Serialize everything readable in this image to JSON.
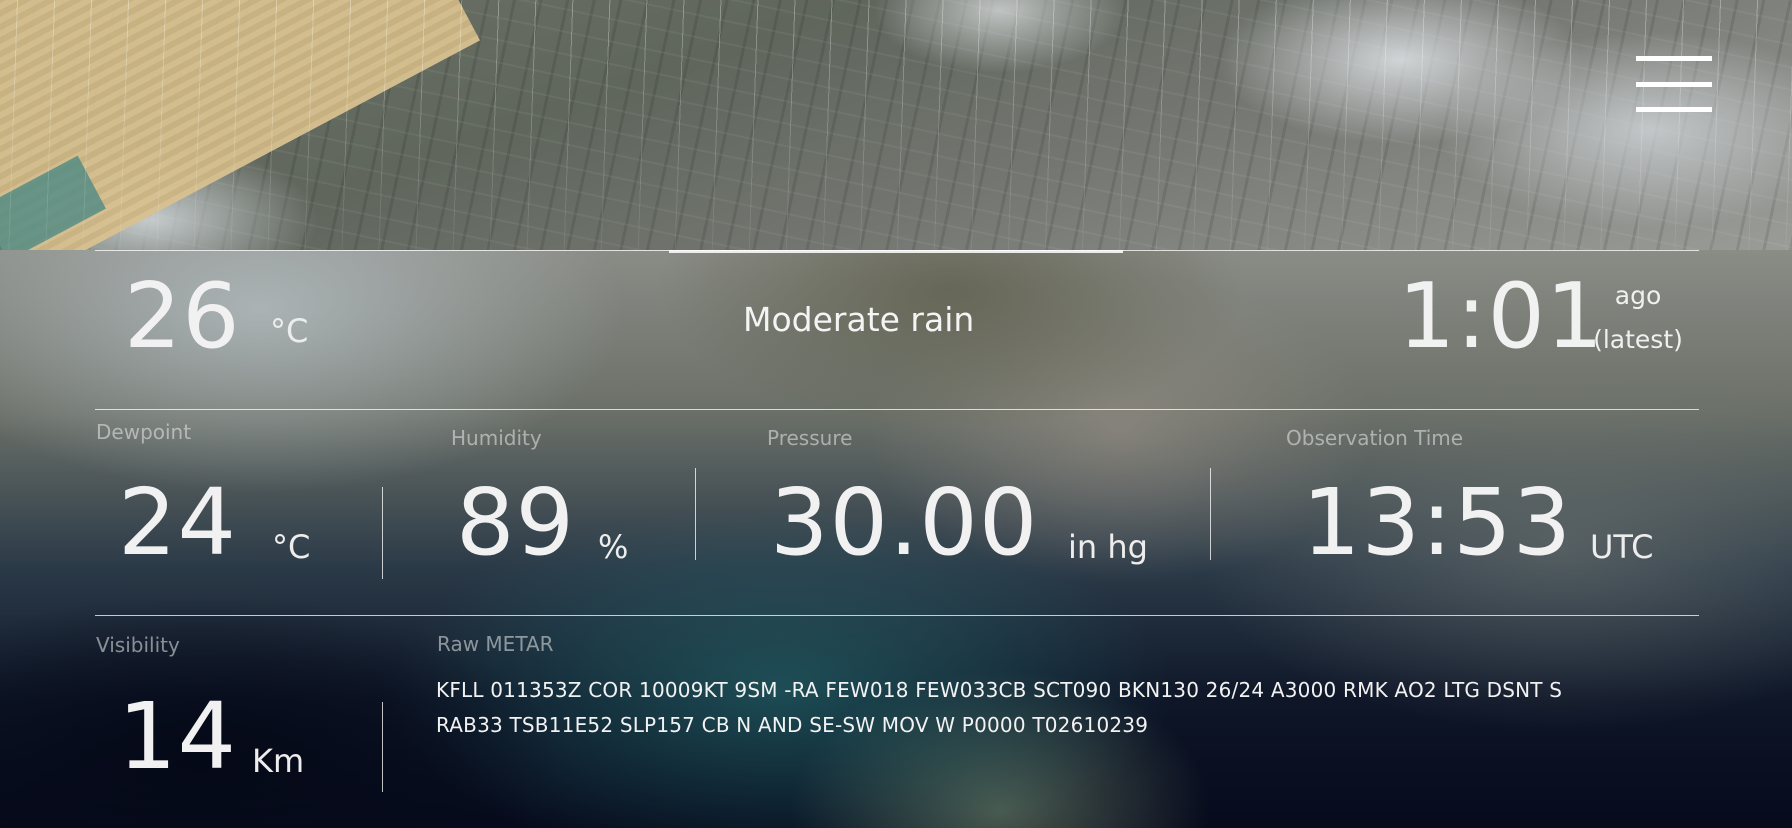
{
  "menu": {
    "icon": "hamburger-menu-icon"
  },
  "current": {
    "temperature": "26",
    "temperature_unit": "°C",
    "condition": "Moderate rain",
    "elapsed": "1:01",
    "elapsed_suffix_1": "ago",
    "elapsed_suffix_2": "(latest)"
  },
  "details": {
    "dewpoint": {
      "label": "Dewpoint",
      "value": "24",
      "unit": "°C"
    },
    "humidity": {
      "label": "Humidity",
      "value": "89",
      "unit": "%"
    },
    "pressure": {
      "label": "Pressure",
      "value": "30.00",
      "unit": "in hg"
    },
    "observation": {
      "label": "Observation Time",
      "value": "13:53",
      "unit": "UTC"
    },
    "visibility": {
      "label": "Visibility",
      "value": "14",
      "unit": "Km"
    },
    "metar": {
      "label": "Raw METAR",
      "line1": "KFLL 011353Z COR 10009KT 9SM -RA FEW018 FEW033CB SCT090 BKN130 26/24 A3000 RMK AO2 LTG DSNT S",
      "line2": "RAB33 TSB11E52 SLP157 CB N AND SE-SW MOV W P0000 T02610239"
    }
  }
}
